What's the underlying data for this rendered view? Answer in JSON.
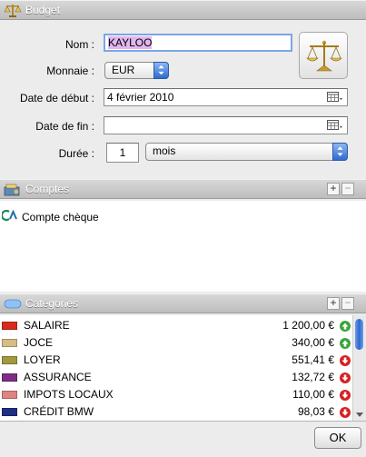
{
  "budget": {
    "header_title": "Budget",
    "name_label": "Nom :",
    "name_value": "KAYLOO",
    "currency_label": "Monnaie :",
    "currency_value": "EUR",
    "start_label": "Date de début :",
    "start_value": "4 février 2010",
    "end_label": "Date de fin :",
    "end_value": "",
    "duration_label": "Durée :",
    "duration_value": "1",
    "duration_unit": "mois"
  },
  "accounts": {
    "header_title": "Comptes",
    "add_label": "+",
    "remove_label": "−",
    "items": [
      {
        "label": "Compte chèque",
        "icon": "bank-logo-icon"
      }
    ]
  },
  "categories": {
    "header_title": "Catégories",
    "add_label": "+",
    "remove_label": "−",
    "items": [
      {
        "name": "SALAIRE",
        "amount": "1 200,00 €",
        "color": "#d92b1c",
        "direction": "up"
      },
      {
        "name": "JOCE",
        "amount": "340,00 €",
        "color": "#d6bd85",
        "direction": "up"
      },
      {
        "name": "LOYER",
        "amount": "551,41 €",
        "color": "#a19a3c",
        "direction": "down"
      },
      {
        "name": "ASSURANCE",
        "amount": "132,72 €",
        "color": "#7e2d86",
        "direction": "down"
      },
      {
        "name": "IMPOTS LOCAUX",
        "amount": "110,00 €",
        "color": "#e08383",
        "direction": "down"
      },
      {
        "name": "CRÉDIT BMW",
        "amount": "98,03 €",
        "color": "#1f2f86",
        "direction": "down"
      }
    ]
  },
  "footer": {
    "ok_label": "OK"
  },
  "colors": {
    "up": "#3aa53a",
    "down": "#d62020",
    "accent": "#2e6cd3",
    "name_highlight": "#e2b6ef"
  }
}
